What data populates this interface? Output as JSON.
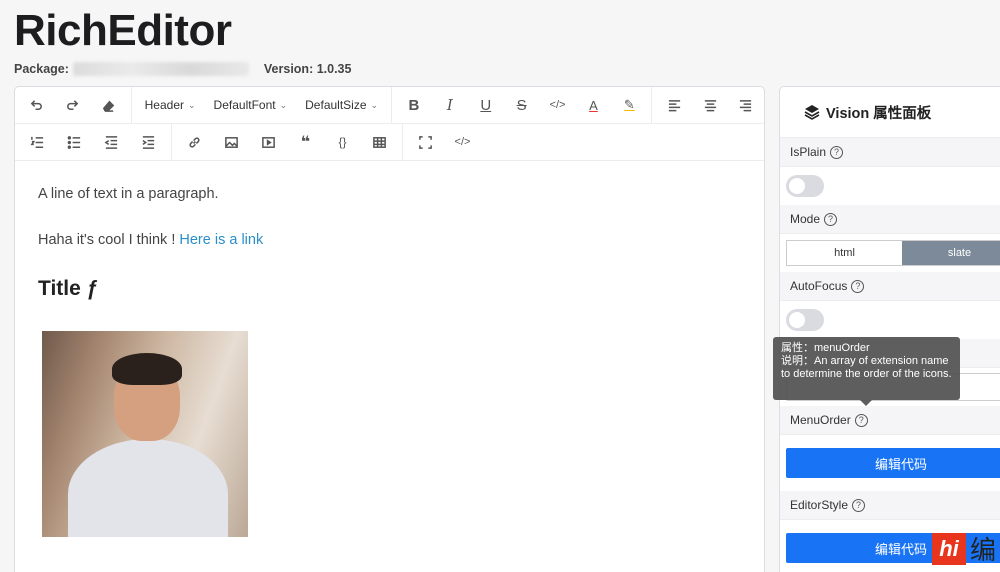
{
  "header": {
    "title": "RichEditor",
    "package_label": "Package:",
    "version_label": "Version: 1.0.35"
  },
  "toolbar": {
    "row1": {
      "undo_icon": "undo-icon",
      "redo_icon": "redo-icon",
      "clear_format_icon": "eraser-icon",
      "header_label": "Header",
      "font_label": "DefaultFont",
      "size_label": "DefaultSize",
      "bold": "B",
      "italic": "I",
      "underline": "U",
      "strike": "S",
      "code": "</>",
      "font_color": "A",
      "highlight": "✎",
      "align_left_icon": "align-left-icon",
      "align_center_icon": "align-center-icon",
      "align_right_icon": "align-right-icon"
    },
    "row2": {
      "ordered_list_icon": "ordered-list-icon",
      "bullet_list_icon": "bullet-list-icon",
      "outdent_icon": "outdent-icon",
      "indent_icon": "indent-icon",
      "link_icon": "link-icon",
      "image_icon": "image-icon",
      "video_icon": "video-icon",
      "quote": "❝",
      "code_block": "{}",
      "table_icon": "table-icon",
      "fullscreen_icon": "fullscreen-icon",
      "source": "</>"
    }
  },
  "content": {
    "paragraph1": "A line of text in a paragraph.",
    "paragraph2_text": "Haha it's cool I think ! ",
    "paragraph2_link": "Here is a link",
    "heading": "Title ƒ",
    "image_alt": "photo"
  },
  "panel": {
    "title": "Vision 属性面板",
    "props": {
      "isplain": "IsPlain",
      "mode": "Mode",
      "mode_options": [
        "html",
        "slate"
      ],
      "autofocus": "AutoFocus",
      "menuorder": "MenuOrder",
      "menuorder_button": "编辑代码",
      "editorstyle": "EditorStyle",
      "editorstyle_button": "编辑代码"
    },
    "help": "?"
  },
  "tooltip": {
    "line1": "属性：menuOrder",
    "line2": "说明：An array of extension name to determine the order of the icons."
  },
  "watermark": {
    "logo": "hi",
    "text": "编"
  },
  "colors": {
    "link": "#2a8fc8",
    "primary_button": "#1874f5",
    "segment_active": "#7d8a99"
  }
}
